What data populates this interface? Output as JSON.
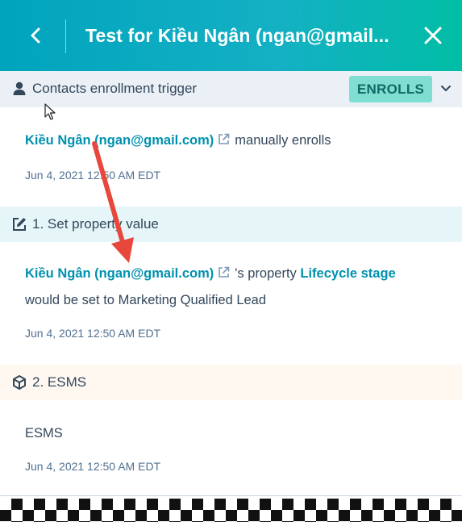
{
  "header": {
    "title": "Test for Kiều Ngân (ngan@gmail...",
    "back_icon": "chevron-left-icon",
    "close_icon": "close-icon"
  },
  "trigger": {
    "label": "Contacts enrollment trigger",
    "badge": "ENROLLS",
    "icon": "contact-person-icon",
    "contact_name": "Kiều Ngân (ngan@gmail.com)",
    "action_text": "manually enrolls",
    "timestamp": "Jun 4, 2021 12:50 AM EDT"
  },
  "action1": {
    "label": "1. Set property value",
    "icon": "edit-icon",
    "contact_name": "Kiều Ngân (ngan@gmail.com)",
    "possessive_text": "'s property",
    "property_name": "Lifecycle stage",
    "would_text": "would be set to",
    "value": "Marketing Qualified Lead",
    "timestamp": "Jun 4, 2021 12:50 AM EDT"
  },
  "action2": {
    "label": "2. ESMS",
    "icon": "cube-icon",
    "body": "ESMS",
    "timestamp": "Jun 4, 2021 12:50 AM EDT"
  },
  "colors": {
    "header_start": "#00a4bd",
    "header_end": "#00bda5",
    "link": "#0091ae",
    "badge_bg": "#7fded2",
    "annotation_arrow": "#e8473c"
  }
}
